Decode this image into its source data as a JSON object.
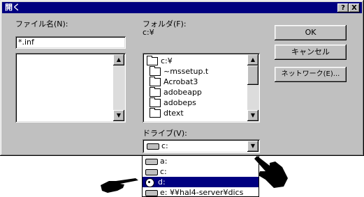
{
  "window": {
    "title": "開く"
  },
  "title_buttons": {
    "help": "?",
    "close": "X"
  },
  "file_name": {
    "label": "ファイル名(N):",
    "value": "*.inf"
  },
  "folder": {
    "label": "フォルダ(F):",
    "current": "c:¥",
    "items": [
      {
        "name": "c:¥",
        "icon": "open-folder-icon"
      },
      {
        "name": "~mssetup.t",
        "icon": "folder-icon"
      },
      {
        "name": "Acrobat3",
        "icon": "folder-icon"
      },
      {
        "name": "adobeapp",
        "icon": "folder-icon"
      },
      {
        "name": "adobeps",
        "icon": "folder-icon"
      },
      {
        "name": "dtext",
        "icon": "folder-icon"
      }
    ]
  },
  "buttons": {
    "ok": "OK",
    "cancel": "キャンセル",
    "network": "ネットワーク(E)..."
  },
  "drive": {
    "label": "ドライブ(V):",
    "selected": "c:",
    "options": [
      {
        "name": "a:",
        "icon": "floppy-drive-icon"
      },
      {
        "name": "c:",
        "icon": "hard-drive-icon"
      },
      {
        "name": "d:",
        "icon": "cd-drive-icon",
        "highlighted": true
      },
      {
        "name": "e: ¥¥hal4-server¥dics",
        "icon": "network-drive-icon"
      }
    ]
  },
  "colors": {
    "title_bar": "#000080",
    "selection": "#000080",
    "face": "#c0c0c0"
  }
}
